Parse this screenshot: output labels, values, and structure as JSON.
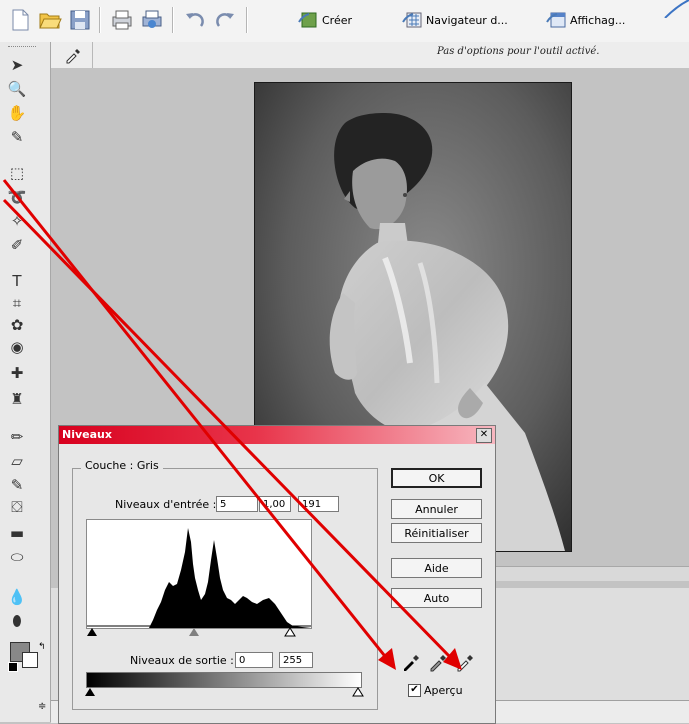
{
  "toolbar": {
    "create_label": "Créer",
    "navigator_label": "Navigateur d...",
    "display_label": "Affichag..."
  },
  "options_bar": {
    "message": "Pas d'options pour l'outil activé."
  },
  "tools": [
    {
      "name": "move-tool-icon",
      "glyph": "➤"
    },
    {
      "name": "zoom-tool-icon",
      "glyph": "🔍"
    },
    {
      "name": "hand-tool-icon",
      "glyph": "✋"
    },
    {
      "name": "eyedropper-tool-icon",
      "glyph": "✎"
    },
    {
      "name": "marquee-tool-icon",
      "glyph": "⬚"
    },
    {
      "name": "lasso-tool-icon",
      "glyph": "➰"
    },
    {
      "name": "magic-wand-tool-icon",
      "glyph": "✧"
    },
    {
      "name": "selection-brush-tool-icon",
      "glyph": "✐"
    },
    {
      "name": "type-tool-icon",
      "glyph": "T"
    },
    {
      "name": "crop-tool-icon",
      "glyph": "⌗"
    },
    {
      "name": "cookie-cutter-tool-icon",
      "glyph": "✿"
    },
    {
      "name": "red-eye-tool-icon",
      "glyph": "◉"
    },
    {
      "name": "healing-brush-tool-icon",
      "glyph": "✚"
    },
    {
      "name": "clone-stamp-tool-icon",
      "glyph": "♜"
    },
    {
      "name": "pencil-tool-icon",
      "glyph": "✏"
    },
    {
      "name": "eraser-tool-icon",
      "glyph": "▱"
    },
    {
      "name": "brush-tool-icon",
      "glyph": "✎"
    },
    {
      "name": "paint-bucket-tool-icon",
      "glyph": "⛋"
    },
    {
      "name": "gradient-tool-icon",
      "glyph": "▬"
    },
    {
      "name": "shape-tool-icon",
      "glyph": "⬭"
    },
    {
      "name": "blur-tool-icon",
      "glyph": "💧"
    },
    {
      "name": "sponge-tool-icon",
      "glyph": "⬮"
    }
  ],
  "dialog": {
    "title": "Niveaux",
    "channel_label": "Couche : Gris",
    "input_levels_label": "Niveaux d'entrée :",
    "input_black": "5",
    "input_gamma": "1,00",
    "input_white": "191",
    "output_levels_label": "Niveaux de sortie :",
    "output_black": "0",
    "output_white": "255",
    "buttons": {
      "ok": "OK",
      "cancel": "Annuler",
      "reset": "Réinitialiser",
      "help": "Aide",
      "auto": "Auto"
    },
    "preview_label": "Aperçu",
    "preview_checked": true
  }
}
